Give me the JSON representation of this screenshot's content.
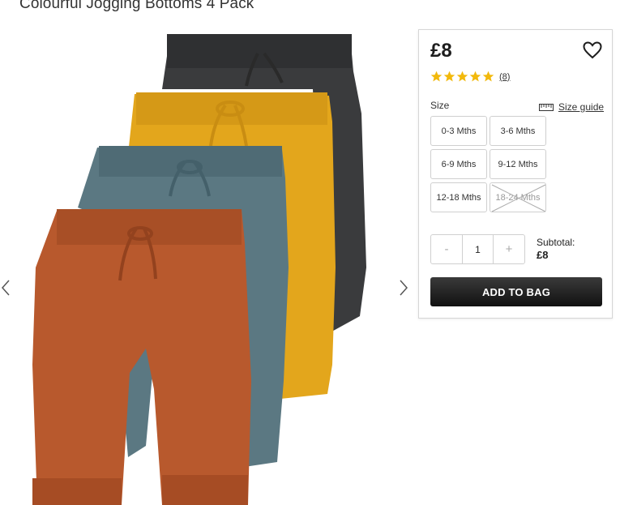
{
  "product": {
    "title": "Colourful Jogging Bottoms 4 Pack",
    "price": "£8",
    "rating": 5,
    "review_count": "(8)"
  },
  "sizes": {
    "label": "Size",
    "guide_label": "Size guide",
    "options": [
      {
        "label": "0-3 Mths",
        "available": true
      },
      {
        "label": "3-6 Mths",
        "available": true
      },
      {
        "label": "6-9 Mths",
        "available": true
      },
      {
        "label": "9-12 Mths",
        "available": true
      },
      {
        "label": "12-18 Mths",
        "available": true
      },
      {
        "label": "18-24 Mths",
        "available": false
      }
    ]
  },
  "quantity": {
    "minus": "-",
    "value": "1",
    "plus": "+"
  },
  "subtotal": {
    "label": "Subtotal:",
    "value": "£8"
  },
  "add_to_bag": "ADD TO BAG",
  "colors": {
    "trouser_charcoal": "#3a3b3d",
    "trouser_mustard": "#e3a61c",
    "trouser_teal": "#5b7882",
    "trouser_rust": "#b8592d",
    "star": "#f2b90c",
    "button": "#1d1d1d"
  },
  "icons": {
    "wishlist": "heart-outline-icon",
    "size_guide": "ruler-icon",
    "prev": "chevron-left-icon",
    "next": "chevron-right-icon",
    "star": "star-icon"
  }
}
